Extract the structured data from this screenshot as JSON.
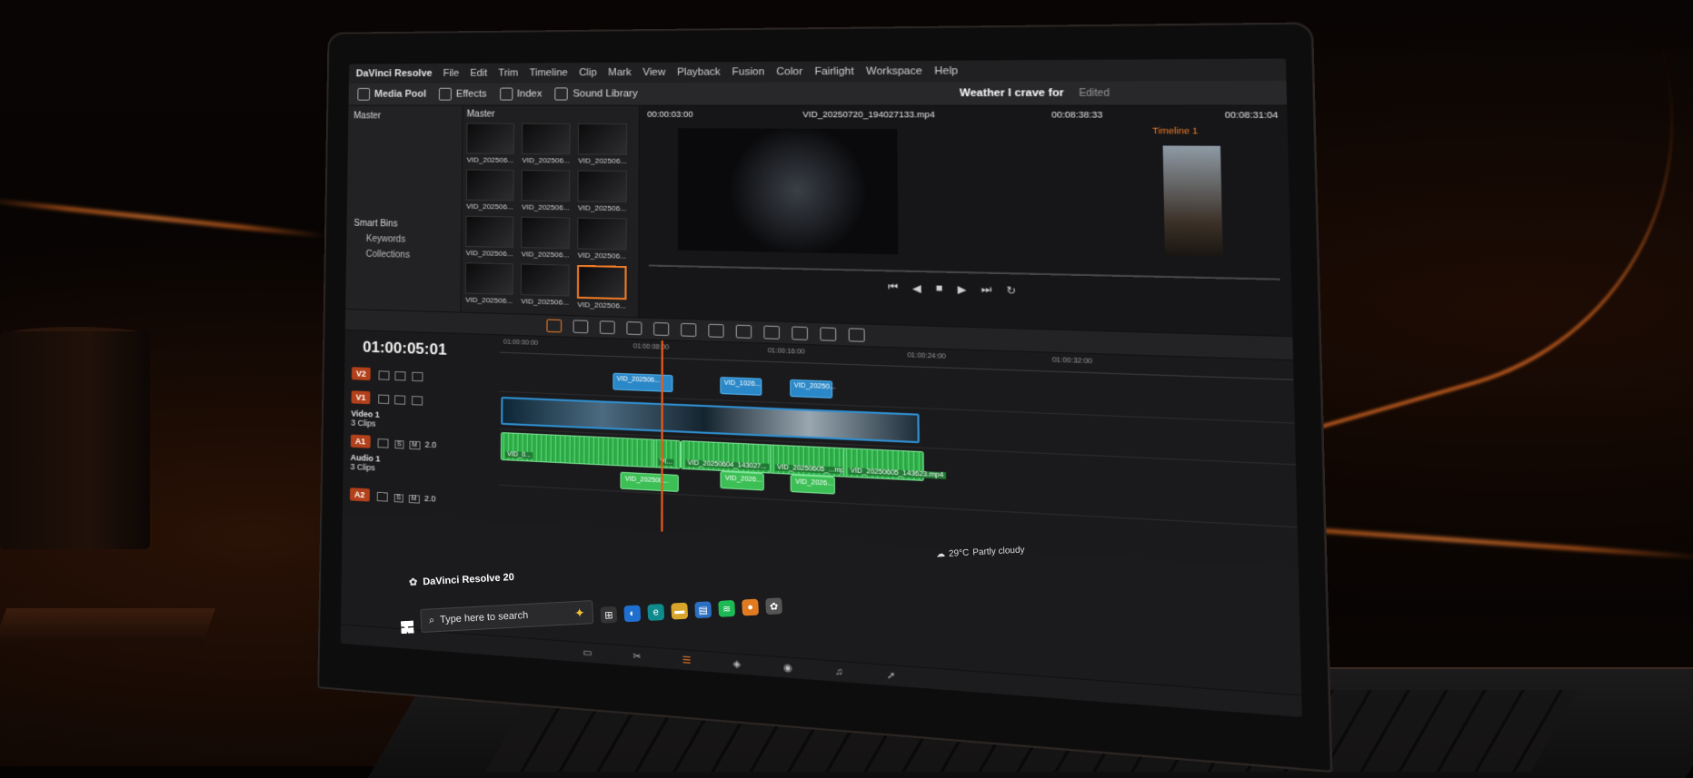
{
  "menubar": {
    "app_name": "DaVinci Resolve",
    "items": [
      "File",
      "Edit",
      "Trim",
      "Timeline",
      "Clip",
      "Mark",
      "View",
      "Playback",
      "Fusion",
      "Color",
      "Fairlight",
      "Workspace",
      "Help"
    ]
  },
  "toolbar": {
    "media_pool": "Media Pool",
    "effects": "Effects",
    "index": "Index",
    "sound_library": "Sound Library",
    "project_title": "Weather I crave for",
    "edited": "Edited"
  },
  "bins": {
    "master": "Master",
    "smart_bins": "Smart Bins",
    "keywords": "Keywords",
    "collections": "Collections"
  },
  "media_pool": {
    "header": "Master",
    "clips": [
      "VID_202506...",
      "VID_202506...",
      "VID_202506...",
      "VID_202506...",
      "VID_202506...",
      "VID_202506...",
      "VID_202506...",
      "VID_202506...",
      "VID_202506...",
      "VID_202506...",
      "VID_202506...",
      "VID_202506..."
    ],
    "selected_index": 11
  },
  "viewer": {
    "source_timecode": "00:00:03:00",
    "clip_name": "VID_20250720_194027133.mp4",
    "duration_a": "00:08:38:33",
    "duration_b": "00:08:31:04",
    "timeline_name": "Timeline 1"
  },
  "timeline": {
    "timecode": "01:00:05:01",
    "ruler": [
      "01:00:00:00",
      "01:00:08:00",
      "01:00:16:00",
      "01:00:24:00",
      "01:00:32:00"
    ],
    "tracks": {
      "v2": "V2",
      "v1": "V1",
      "video1_name": "Video 1",
      "video1_count": "3 Clips",
      "a1": "A1",
      "audio1_name": "Audio 1",
      "audio1_count": "3 Clips",
      "a2": "A2",
      "a_level": "2.0",
      "solo": "S",
      "mute": "M"
    },
    "v2_clips": [
      "VID_202506...",
      "VID_1026...",
      "VID_20250..."
    ],
    "audio_clips": [
      "VID_0...",
      "VI...",
      "VID_20250604_143027...",
      "VID_20250605_...mp4",
      "VID_20250605_143623.mp4"
    ],
    "a2_clips": [
      "VID_202500...",
      "VID_2026...",
      "VID_2026..."
    ]
  },
  "taskbar": {
    "app_title": "DaVinci Resolve 20",
    "search_placeholder": "Type here to search",
    "weather_temp": "29°C",
    "weather_text": "Partly cloudy"
  },
  "colors": {
    "accent": "#f07a25",
    "video_clip": "#2f8fd0",
    "audio_clip": "#3cbf55",
    "track_badge": "#b2401a"
  }
}
